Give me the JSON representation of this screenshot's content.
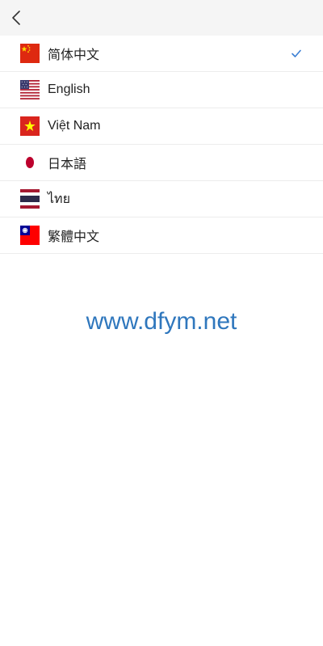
{
  "header": {
    "back_icon": "chevron-left-icon"
  },
  "languages": [
    {
      "label": "简体中文",
      "flag": "china-flag-icon",
      "selected": true
    },
    {
      "label": "English",
      "flag": "usa-flag-icon",
      "selected": false
    },
    {
      "label": "Việt Nam",
      "flag": "vietnam-flag-icon",
      "selected": false
    },
    {
      "label": "日本語",
      "flag": "japan-flag-icon",
      "selected": false
    },
    {
      "label": "ไทย",
      "flag": "thailand-flag-icon",
      "selected": false
    },
    {
      "label": "繁體中文",
      "flag": "taiwan-flag-icon",
      "selected": false
    }
  ],
  "selected_marker_icon": "checkmark-icon",
  "watermark": {
    "text": "www.dfym.net"
  },
  "colors": {
    "header_bg": "#f5f5f5",
    "divider": "#ececec",
    "text": "#222222",
    "accent": "#3b7fd4",
    "watermark": "#2f77bd"
  }
}
